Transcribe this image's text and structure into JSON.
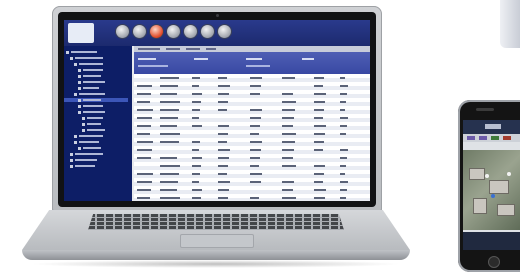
{
  "app": {
    "logo_line1": "",
    "logo_line2": ""
  },
  "colors": {
    "screen_header": "#1c2a6e",
    "tree_panel": "#0d1e66",
    "tree_selected": "#3c56b8",
    "table_header": "#3848a3",
    "laptop_aluminum": "#c5c8cc",
    "orb_accent": "#e24d2a"
  },
  "icons": [
    "app-logo",
    "toolbar-orb-icon",
    "tree-node-icon",
    "phone-home-button"
  ]
}
